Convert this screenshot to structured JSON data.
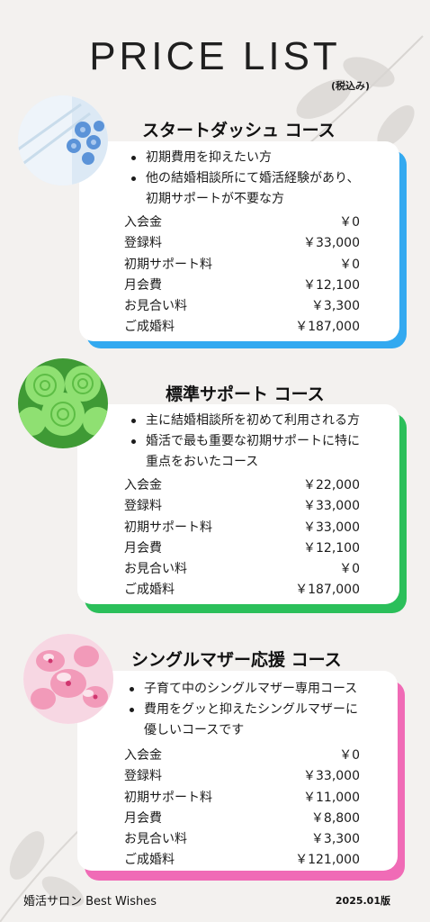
{
  "header": {
    "title": "PRICE LIST",
    "tax_note": "(税込み)"
  },
  "courses": [
    {
      "title": "スタートダッシュ コース",
      "accent": "#33a9f0",
      "photo": "blue-flowers-photo",
      "bullets": [
        "初期費用を抑えたい方",
        "他の結婚相談所にて婚活経験があり、",
        "初期サポートが不要な方"
      ],
      "fees": [
        {
          "label": "入会金",
          "value": "￥0"
        },
        {
          "label": "登録料",
          "value": "￥33,000"
        },
        {
          "label": "初期サポート料",
          "value": "￥0"
        },
        {
          "label": "月会費",
          "value": "￥12,100"
        },
        {
          "label": "お見合い料",
          "value": "￥3,300"
        },
        {
          "label": "ご成婚料",
          "value": "￥187,000"
        }
      ]
    },
    {
      "title": "標準サポート コース",
      "accent": "#2bbf5a",
      "photo": "green-roses-photo",
      "bullets": [
        "主に結婚相談所を初めて利用される方",
        "婚活で最も重要な初期サポートに特に",
        "重点をおいたコース"
      ],
      "fees": [
        {
          "label": "入会金",
          "value": "￥22,000"
        },
        {
          "label": "登録料",
          "value": "￥33,000"
        },
        {
          "label": "初期サポート料",
          "value": "￥33,000"
        },
        {
          "label": "月会費",
          "value": "￥12,100"
        },
        {
          "label": "お見合い料",
          "value": "￥0"
        },
        {
          "label": "ご成婚料",
          "value": "￥187,000"
        }
      ]
    },
    {
      "title": "シングルマザー応援 コース",
      "accent": "#f06bb6",
      "photo": "pink-flowers-photo",
      "bullets": [
        "子育て中のシングルマザー専用コース",
        "費用をグッと抑えたシングルマザーに",
        "優しいコースです"
      ],
      "fees": [
        {
          "label": "入会金",
          "value": "￥0"
        },
        {
          "label": "登録料",
          "value": "￥33,000"
        },
        {
          "label": "初期サポート料",
          "value": "￥11,000"
        },
        {
          "label": "月会費",
          "value": "￥8,800"
        },
        {
          "label": "お見合い料",
          "value": "￥3,300"
        },
        {
          "label": "ご成婚料",
          "value": "￥121,000"
        }
      ]
    }
  ],
  "footer": {
    "brand": "婚活サロン Best Wishes",
    "edition": "2025.01版"
  }
}
